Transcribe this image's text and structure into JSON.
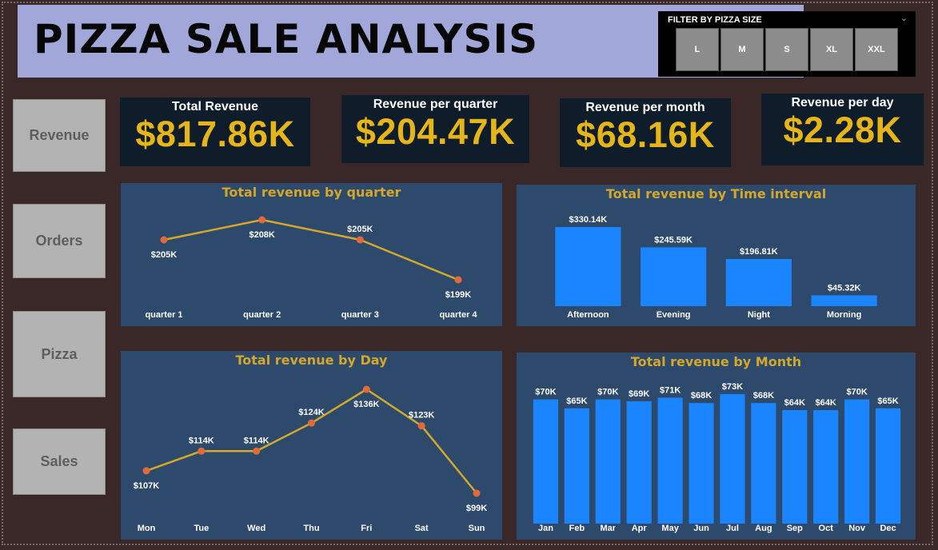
{
  "header": {
    "title": "PIZZA SALE ANALYSIS"
  },
  "filter": {
    "title": "FILTER BY PIZZA SIZE",
    "sizes": [
      "L",
      "M",
      "S",
      "XL",
      "XXL"
    ]
  },
  "nav": [
    "Revenue",
    "Orders",
    "Pizza",
    "Sales"
  ],
  "kpis": [
    {
      "label": "Total Revenue",
      "value": "$817.86K"
    },
    {
      "label": "Revenue per quarter",
      "value": "$204.47K"
    },
    {
      "label": "Revenue per month",
      "value": "$68.16K"
    },
    {
      "label": "Revenue per day",
      "value": "$2.28K"
    }
  ],
  "colors": {
    "line": "#d4a82a",
    "point": "#e06a3a",
    "bar": "#1a85ff",
    "title": "#d4a72a"
  },
  "chart_data": [
    {
      "type": "line",
      "title": "Total revenue by quarter",
      "categories": [
        "quarter 1",
        "quarter 2",
        "quarter 3",
        "quarter 4"
      ],
      "values": [
        205,
        208,
        205,
        199
      ],
      "labels": [
        "$205K",
        "$208K",
        "$205K",
        "$199K"
      ],
      "unit": "K"
    },
    {
      "type": "bar",
      "title": "Total revenue by Time interval",
      "categories": [
        "Afternoon",
        "Evening",
        "Night",
        "Morning"
      ],
      "values": [
        330.14,
        245.59,
        196.81,
        45.32
      ],
      "labels": [
        "$330.14K",
        "$245.59K",
        "$196.81K",
        "$45.32K"
      ]
    },
    {
      "type": "line",
      "title": "Total revenue by Day",
      "categories": [
        "Mon",
        "Tue",
        "Wed",
        "Thu",
        "Fri",
        "Sat",
        "Sun"
      ],
      "values": [
        107,
        114,
        114,
        124,
        136,
        123,
        99
      ],
      "labels": [
        "$107K",
        "$114K",
        "$114K",
        "$124K",
        "$136K",
        "$123K",
        "$99K"
      ]
    },
    {
      "type": "bar",
      "title": "Total revenue by Month",
      "categories": [
        "Jan",
        "Feb",
        "Mar",
        "Apr",
        "May",
        "Jun",
        "Jul",
        "Aug",
        "Sep",
        "Oct",
        "Nov",
        "Dec"
      ],
      "values": [
        70,
        65,
        70,
        69,
        71,
        68,
        73,
        68,
        64,
        64,
        70,
        65
      ],
      "labels": [
        "$70K",
        "$65K",
        "$70K",
        "$69K",
        "$71K",
        "$68K",
        "$73K",
        "$68K",
        "$64K",
        "$64K",
        "$70K",
        "$65K"
      ]
    }
  ]
}
